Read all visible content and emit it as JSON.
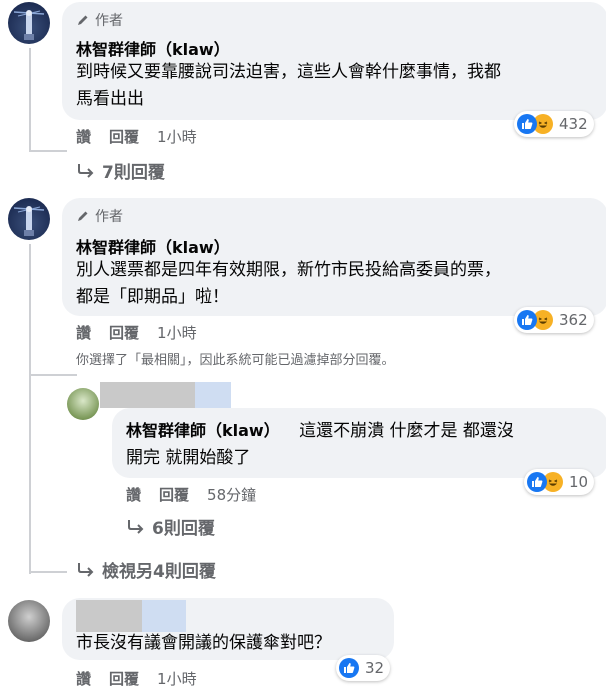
{
  "comments": [
    {
      "author_tag": "作者",
      "name": "林智群律師（klaw）",
      "text_lines": [
        "到時候又要靠腰說司法迫害，這些人會幹什麼事情，我都",
        "馬看出出"
      ],
      "actions": {
        "like": "讚",
        "reply": "回覆",
        "time": "1小時"
      },
      "reactions": {
        "count": "432",
        "types": [
          "like-icon",
          "haha-icon"
        ]
      },
      "replies_link": "7則回覆"
    },
    {
      "author_tag": "作者",
      "name": "林智群律師（klaw）",
      "text_lines": [
        "別人選票都是四年有效期限，新竹市民投給高委員的票，",
        "都是「即期品」啦！"
      ],
      "actions": {
        "like": "讚",
        "reply": "回覆",
        "time": "1小時"
      },
      "reactions": {
        "count": "362",
        "types": [
          "like-icon",
          "haha-icon"
        ]
      },
      "filter_note": "你選擇了「最相關」，因此系統可能已過濾掉部分回覆。",
      "reply": {
        "name": "林智群律師（klaw）",
        "text_first": "這還不崩潰 什麼才是 都還沒",
        "text_second": "開完 就開始酸了",
        "actions": {
          "like": "讚",
          "reply": "回覆",
          "time": "58分鐘"
        },
        "reactions": {
          "count": "10",
          "types": [
            "like-icon",
            "haha-icon"
          ]
        },
        "replies_link": "6則回覆"
      },
      "more_replies_link": "檢視另4則回覆"
    },
    {
      "text": "市長沒有議會開議的保護傘對吧？",
      "actions": {
        "like": "讚",
        "reply": "回覆",
        "time": "1小時"
      },
      "reactions": {
        "count": "32",
        "types": [
          "like-icon"
        ]
      }
    }
  ],
  "colors": {
    "like_blue": "#1877f2",
    "haha_yellow": "#f7b125",
    "bubble_gray": "#f0f2f5",
    "meta_gray": "#65676b"
  }
}
